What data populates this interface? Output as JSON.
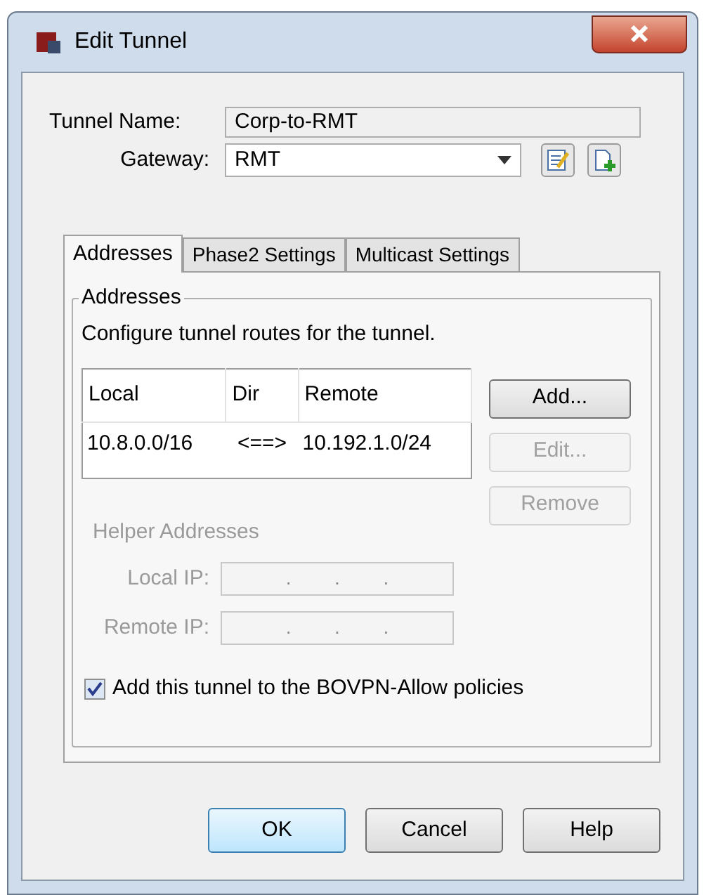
{
  "window": {
    "title": "Edit Tunnel"
  },
  "tunnel_name": {
    "label": "Tunnel Name:",
    "value": "Corp-to-RMT"
  },
  "gateway": {
    "label": "Gateway:",
    "value": "RMT"
  },
  "tabs": [
    {
      "label": "Addresses",
      "selected": true
    },
    {
      "label": "Phase2 Settings",
      "selected": false
    },
    {
      "label": "Multicast Settings",
      "selected": false
    }
  ],
  "addresses": {
    "group_title": "Addresses",
    "description": "Configure tunnel routes for the tunnel.",
    "table": {
      "columns": [
        "Local",
        "Dir",
        "Remote"
      ],
      "rows": [
        [
          "10.8.0.0/16",
          "<==>",
          "10.192.1.0/24"
        ]
      ]
    },
    "buttons": [
      {
        "label": "Add...",
        "disabled": false
      },
      {
        "label": "Edit...",
        "disabled": true
      },
      {
        "label": "Remove",
        "disabled": true
      }
    ],
    "helper": {
      "title": "Helper Addresses",
      "disabled": true,
      "fields": [
        {
          "label": "Local IP:",
          "separator": "."
        },
        {
          "label": "Remote IP:",
          "separator": "."
        }
      ]
    },
    "policy_checkbox": {
      "label": "Add this tunnel to the BOVPN-Allow policies",
      "checked": true
    }
  },
  "footer_buttons": [
    {
      "label": "OK",
      "default": true
    },
    {
      "label": "Cancel",
      "default": false
    },
    {
      "label": "Help",
      "default": false
    }
  ]
}
